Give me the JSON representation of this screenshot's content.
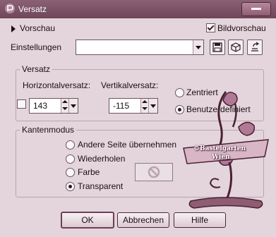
{
  "window": {
    "title": "Versatz",
    "close_icon": "minimize-icon"
  },
  "top": {
    "preview_label": "Vorschau",
    "image_preview_label": "Bildvorschau",
    "image_preview_checked": true,
    "settings_label": "Einstellungen",
    "settings_value": ""
  },
  "versatz": {
    "group_label": "Versatz",
    "horizontal_label": "Horizontalversatz:",
    "vertical_label": "Vertikalversatz:",
    "horizontal_value": "143",
    "vertical_value": "-115",
    "centered_label": "Zentriert",
    "custom_label": "Benutzerdefiniert",
    "selected": "custom"
  },
  "edge_mode": {
    "group_label": "Kantenmodus",
    "options": [
      "Andere Seite übernehmen",
      "Wiederholen",
      "Farbe",
      "Transparent"
    ],
    "selected": "Transparent"
  },
  "buttons": {
    "ok": "OK",
    "cancel": "Abbrechen",
    "help": "Hilfe"
  },
  "watermark": {
    "line1": "©Bastelgarten",
    "line2": "Wien"
  },
  "colors": {
    "title_bar": "#7a5066",
    "window_bg": "#e3d5db",
    "accent": "#6d3f55"
  }
}
